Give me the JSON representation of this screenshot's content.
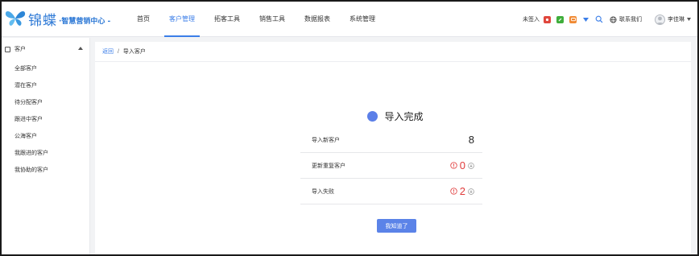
{
  "brand": {
    "name": "锦蝶",
    "subtitle": "·智慧营销中心 -"
  },
  "nav": {
    "items": [
      {
        "label": "首页"
      },
      {
        "label": "客户管理",
        "active": true
      },
      {
        "label": "拓客工具"
      },
      {
        "label": "销售工具"
      },
      {
        "label": "数据报表"
      },
      {
        "label": "系统管理"
      }
    ]
  },
  "toolbar": {
    "checkin_label": "未签入",
    "contact_label": "联系我们",
    "user_name": "李佳琳",
    "colors": {
      "red": "#e0463c",
      "green": "#3fae3b",
      "orange": "#f08a34",
      "blue": "#3b7ee8"
    }
  },
  "sidebar": {
    "header": "客户",
    "items": [
      {
        "label": "全部客户"
      },
      {
        "label": "潜在客户"
      },
      {
        "label": "待分配客户"
      },
      {
        "label": "跟进中客户"
      },
      {
        "label": "公海客户"
      },
      {
        "label": "我跟进的客户"
      },
      {
        "label": "我协助的客户"
      }
    ]
  },
  "breadcrumb": {
    "back": "返回",
    "separator": "/",
    "current": "导入客户"
  },
  "result": {
    "title": "导入完成",
    "rows": [
      {
        "label": "导入新客户",
        "value": "8"
      },
      {
        "label": "更新重复客户",
        "value": "0"
      },
      {
        "label": "导入失败",
        "value": "2"
      }
    ],
    "confirm_label": "我知道了"
  }
}
